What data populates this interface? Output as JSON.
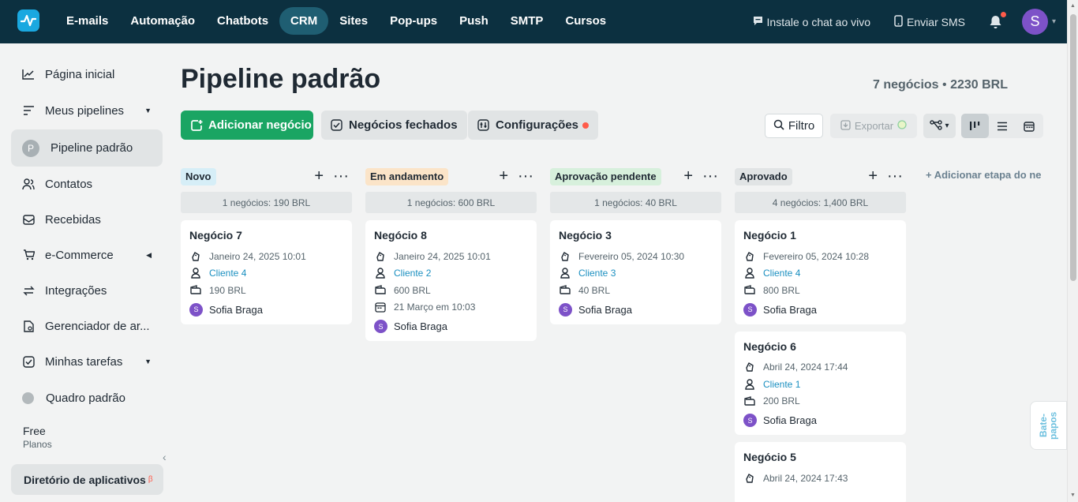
{
  "topnav": {
    "items": [
      "E-mails",
      "Automação",
      "Chatbots",
      "CRM",
      "Sites",
      "Pop-ups",
      "Push",
      "SMTP",
      "Cursos"
    ],
    "live_chat": "Instale o chat ao vivo",
    "send_sms": "Enviar SMS",
    "avatar_letter": "S"
  },
  "sidebar": {
    "items": [
      {
        "label": "Página inicial",
        "icon": "chart-line-icon"
      },
      {
        "label": "Meus pipelines",
        "icon": "pipeline-icon"
      },
      {
        "label": "Pipeline padrão",
        "badge": "P"
      },
      {
        "label": "Contatos",
        "icon": "contacts-icon"
      },
      {
        "label": "Recebidas",
        "icon": "inbox-icon"
      },
      {
        "label": "e-Commerce",
        "icon": "cart-icon"
      },
      {
        "label": "Integrações",
        "icon": "integrations-icon"
      },
      {
        "label": "Gerenciador de ar...",
        "icon": "file-manager-icon"
      },
      {
        "label": "Minhas tarefas",
        "icon": "tasks-icon"
      },
      {
        "label": "Quadro padrão",
        "icon": "gray-dot"
      }
    ],
    "plan_name": "Free",
    "plan_sub": "Planos",
    "app_directory": "Diretório de aplicativos",
    "beta_mark": "β"
  },
  "header": {
    "title": "Pipeline padrão",
    "deals_count": "7 negócios",
    "separator": "•",
    "deals_total": "2230 BRL"
  },
  "toolbar": {
    "add_deal": "Adicionar negócio",
    "closed_deals": "Negócios fechados",
    "settings": "Configurações",
    "filter": "Filtro",
    "export": "Exportar"
  },
  "board": {
    "add_stage": "+ Adicionar etapa do ne",
    "columns": [
      {
        "name": "Novo",
        "color": "#d6eef7",
        "summary": "1 negócios: 190 BRL",
        "cards": [
          {
            "title": "Negócio 7",
            "date": "Janeiro 24, 2025 10:01",
            "client": "Cliente 4",
            "value": "190 BRL",
            "owner": "Sofia Braga",
            "owner_initial": "S"
          }
        ]
      },
      {
        "name": "Em andamento",
        "color": "#fbe4c8",
        "summary": "1 negócios: 600 BRL",
        "cards": [
          {
            "title": "Negócio 8",
            "date": "Janeiro 24, 2025 10:01",
            "client": "Cliente 2",
            "value": "600 BRL",
            "task": "21 Março em 10:03",
            "owner": "Sofia Braga",
            "owner_initial": "S"
          }
        ]
      },
      {
        "name": "Aprovação pendente",
        "color": "#d7f0dc",
        "summary": "1 negócios: 40 BRL",
        "cards": [
          {
            "title": "Negócio 3",
            "date": "Fevereiro 05, 2024 10:30",
            "client": "Cliente 3",
            "value": "40 BRL",
            "owner": "Sofia Braga",
            "owner_initial": "S"
          }
        ]
      },
      {
        "name": "Aprovado",
        "color": "#e1e4e5",
        "summary": "4 negócios: 1,400 BRL",
        "cards": [
          {
            "title": "Negócio 1",
            "date": "Fevereiro 05, 2024 10:28",
            "client": "Cliente 4",
            "value": "800 BRL",
            "owner": "Sofia Braga",
            "owner_initial": "S"
          },
          {
            "title": "Negócio 6",
            "date": "Abril 24, 2024 17:44",
            "client": "Cliente 1",
            "value": "200 BRL",
            "owner": "Sofia Braga",
            "owner_initial": "S"
          },
          {
            "title": "Negócio 5",
            "date": "Abril 24, 2024 17:43"
          }
        ]
      }
    ]
  },
  "chat_tab": "Bate-papos"
}
